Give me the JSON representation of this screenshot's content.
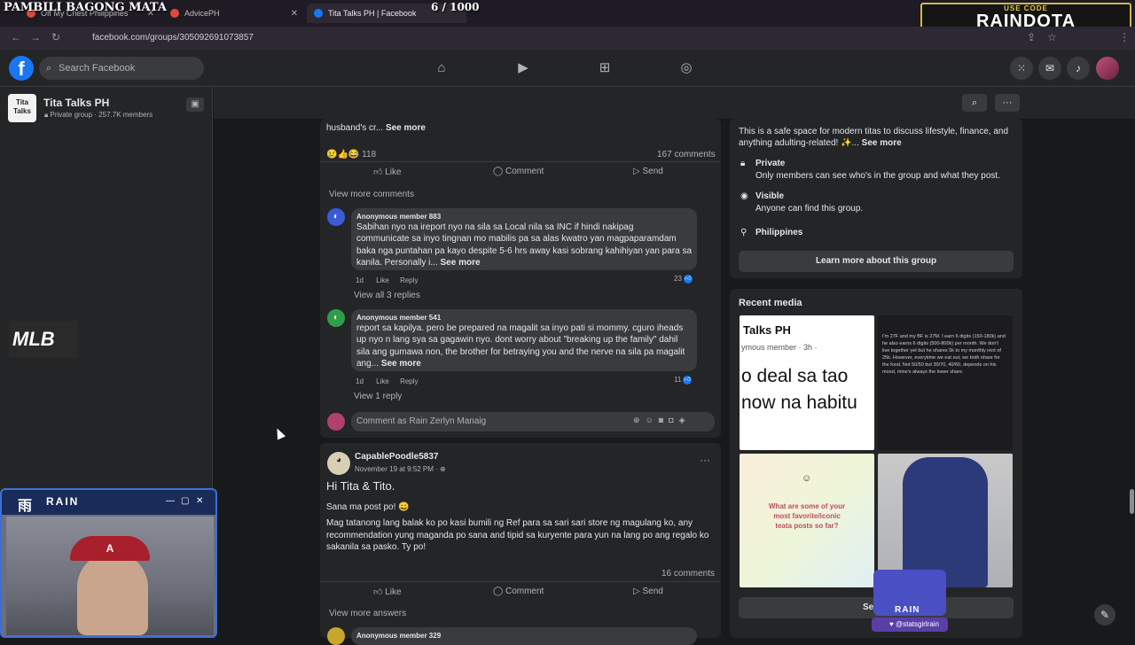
{
  "overlay": {
    "title": "PAMBILI BAGONG MATA",
    "count": "6  / 1000",
    "promo_label": "USE CODE",
    "promo_code": "RAINDOTA"
  },
  "browser": {
    "tabs": [
      {
        "label": "Off My Chest Philippines"
      },
      {
        "label": "AdvicePH"
      },
      {
        "label": "Tita Talks PH | Facebook"
      }
    ],
    "url": "facebook.com/groups/305092691073857"
  },
  "fbnav": {
    "search_placeholder": "Search Facebook"
  },
  "sidebar": {
    "group_name": "Tita Talks PH",
    "group_meta": "Private group · 257.7K members",
    "thumb_text": "Tita Talks"
  },
  "post1": {
    "truncated_text": "husband's cr...",
    "see_more": "See more",
    "reaction_count": "118",
    "comments_count": "167 comments",
    "like": "Like",
    "comment": "Comment",
    "send": "Send",
    "view_more_comments": "View more comments",
    "comments": [
      {
        "author": "Anonymous member 883",
        "lines": [
          "Sabihan nyo na ireport nyo na sila sa Local nila sa INC if hindi nakipag",
          "communicate sa inyo tingnan mo mabilis pa sa alas kwatro yan magpaparamdam",
          "baka nga puntahan pa kayo despite 5-6 hrs away kasi sobrang kahihiyan yan para sa",
          "kanila. Personally i..."
        ],
        "see_more": "See more",
        "time": "1d",
        "like": "Like",
        "reply": "Reply",
        "likes": "23",
        "view_replies": "View all 3 replies"
      },
      {
        "author": "Anonymous member 541",
        "lines": [
          "report sa kapilya. pero be prepared na magalit sa inyo pati si mommy. cguro iheads",
          "up nyo n lang sya sa gagawin nyo. dont worry about \"breaking up the family\" dahil",
          "sila ang gumawa non, the brother for betraying you and the nerve na sila pa magalit",
          "ang..."
        ],
        "see_more": "See more",
        "time": "1d",
        "like": "Like",
        "reply": "Reply",
        "likes": "11",
        "view_replies": "View 1 reply"
      }
    ],
    "comment_as": "Comment as Rain Zerlyn Manaig"
  },
  "post2": {
    "author": "CapablePoodle5837",
    "date": "November 19 at 9:52 PM · ",
    "title": "Hi Tita & Tito.",
    "line1": "Sana ma post po! ",
    "body_lines": [
      "Mag tatanong lang balak ko po kasi bumili ng Ref para sa sari sari store ng magulang ko, any",
      "recommendation yung maganda po sana and tipid sa kuryente para yun na lang po ang regalo ko",
      "sakanila sa pasko. Ty po!"
    ],
    "comments_count": "16 comments",
    "like": "Like",
    "comment": "Comment",
    "send": "Send",
    "view_more_answers": "View more answers",
    "next_comment_author": "Anonymous member 329"
  },
  "about": {
    "desc_line1": "This is a safe space for modern titas to discuss lifestyle, finance, and",
    "desc_line2": "anything adulting-related! ✨...",
    "see_more": "See more",
    "private_title": "Private",
    "private_desc": "Only members can see who's in the group and what they post.",
    "visible_title": "Visible",
    "visible_desc": "Anyone can find this group.",
    "location": "Philippines",
    "learn_more": "Learn more about this group"
  },
  "recent_media": {
    "title": "Recent media",
    "tile1_header": "Talks PH",
    "tile1_meta": "ymous member · 3h ·",
    "tile1_big1": "o deal sa tao",
    "tile1_big2": "now na habitu",
    "tile3_text": "What are some of your most favorite/iconic teata posts so far?",
    "tile2_text": "I'm 27F and my BF is 27M. I earn 6 digits (150-180k) and he also earns 6 digits (500-800k) per month. We don't live together yet but he shares 5k to my monthly rent of 25k. However, everytime we eat out, we both share for the food. Not 50/50 but 30/70, 40/60, depends on his mood, mine's always the lower share.",
    "see_all_partial": "Se"
  },
  "streamer": {
    "cam_title": "RAIN",
    "badge_label": "RAIN",
    "badge_handle": "@statsgirlrain",
    "mlb_logo": "MLB"
  }
}
